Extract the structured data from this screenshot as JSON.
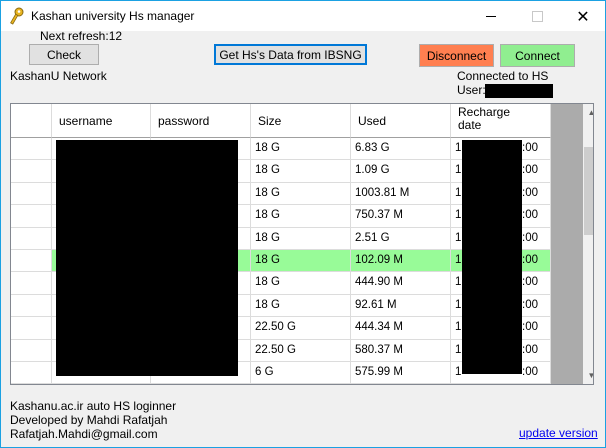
{
  "window": {
    "title": "Kashan university Hs manager",
    "min_glyph": "—",
    "max_glyph": "☐",
    "close_glyph": "✕"
  },
  "top": {
    "next_refresh": "Next refresh:12",
    "check_label": "Check",
    "get_data_label": "Get Hs's Data from IBSNG",
    "disconnect_label": "Disconnect",
    "connect_label": "Connect",
    "network_label": "KashanU Network",
    "connected_label": "Connected to HS",
    "user_label": "User:S"
  },
  "colors": {
    "disconnect": "#ff7f50",
    "connect": "#90ee90",
    "selected_row": "#98fb98",
    "focus_border": "#0078d7"
  },
  "table": {
    "columns": [
      "username",
      "password",
      "Size",
      "Used",
      "Recharge date"
    ],
    "rows": [
      {
        "size": "18 G",
        "used": "6.83 G",
        "date_start": "1",
        "date_end": ":00"
      },
      {
        "size": "18 G",
        "used": "1.09 G",
        "date_start": "1",
        "date_end": ":00"
      },
      {
        "size": "18 G",
        "used": "1003.81 M",
        "date_start": "1",
        "date_end": ":00"
      },
      {
        "size": "18 G",
        "used": "750.37 M",
        "date_start": "1",
        "date_end": ":00"
      },
      {
        "size": "18 G",
        "used": "2.51 G",
        "date_start": "1",
        "date_end": ":00"
      },
      {
        "size": "18 G",
        "used": "102.09 M",
        "date_start": "1",
        "date_end": ":00",
        "selected": true
      },
      {
        "size": "18 G",
        "used": "444.90 M",
        "date_start": "1",
        "date_end": ":00"
      },
      {
        "size": "18 G",
        "used": "92.61 M",
        "date_start": "1",
        "date_end": ":00"
      },
      {
        "size": "22.50 G",
        "used": "444.34 M",
        "date_start": "1",
        "date_end": ":00"
      },
      {
        "size": "22.50 G",
        "used": "580.37 M",
        "date_start": "1",
        "date_end": ":00"
      },
      {
        "size": "6 G",
        "used": "575.99 M",
        "date_start": "1",
        "date_end": ":00"
      }
    ]
  },
  "footer": {
    "line1": "Kashanu.ac.ir auto HS loginner",
    "line2": "Developed by Mahdi Rafatjah",
    "line3": "Rafatjah.Mahdi@gmail.com",
    "update_link": "update version"
  }
}
